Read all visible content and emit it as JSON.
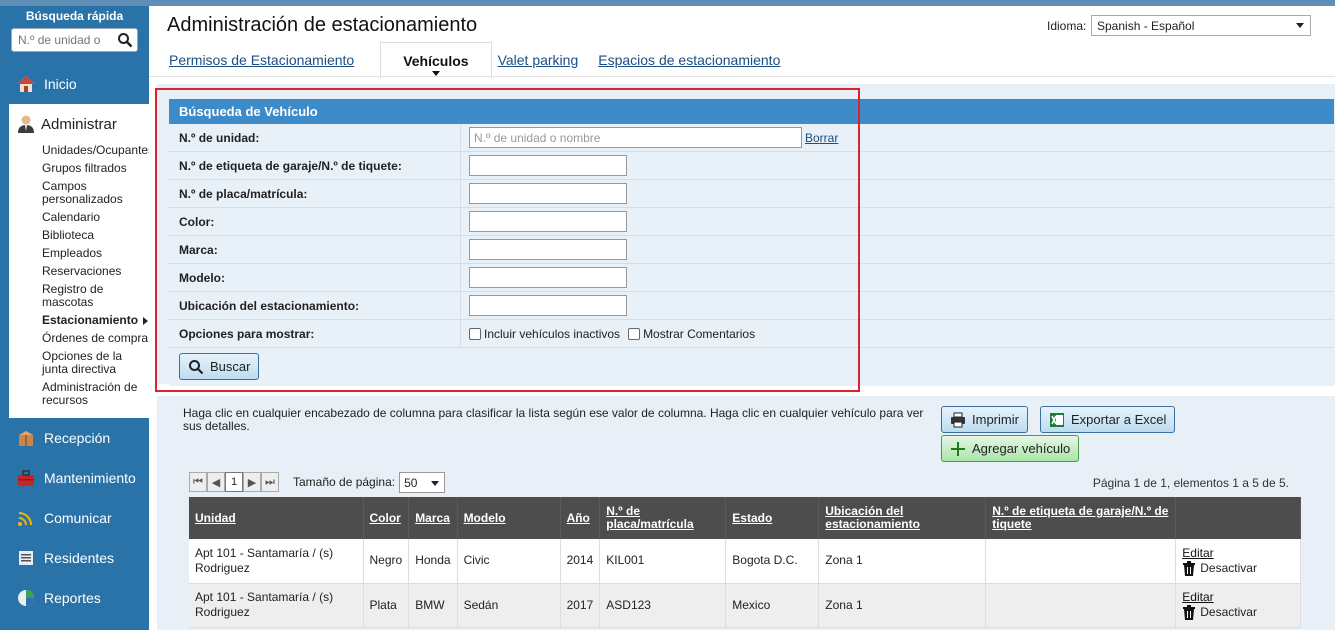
{
  "sidebar": {
    "quick_search_title": "Búsqueda rápida",
    "quick_search_placeholder": "N.º de unidad o",
    "nav": {
      "inicio": "Inicio",
      "administrar": "Administrar",
      "recepcion": "Recepción",
      "mantenimiento": "Mantenimiento",
      "comunicar": "Comunicar",
      "residentes": "Residentes",
      "reportes": "Reportes"
    },
    "admin_items": [
      "Unidades/Ocupantes",
      "Grupos filtrados",
      "Campos personalizados",
      "Calendario",
      "Biblioteca",
      "Empleados",
      "Reservaciones",
      "Registro de mascotas",
      "Estacionamiento",
      "Órdenes de compra",
      "Opciones de la junta directiva",
      "Administración de recursos"
    ]
  },
  "header": {
    "title": "Administración de estacionamiento",
    "language_label": "Idioma:",
    "language_value": "Spanish - Español"
  },
  "tabs": [
    "Permisos de Estacionamiento",
    "Vehículos",
    "Valet parking",
    "Espacios de estacionamiento"
  ],
  "search": {
    "title": "Búsqueda de Vehículo",
    "unit_label": "N.º de unidad:",
    "unit_placeholder": "N.º de unidad o nombre",
    "clear_label": "Borrar",
    "tag_label": "N.º de etiqueta de garaje/N.º de tiquete:",
    "plate_label": "N.º de placa/matrícula:",
    "color_label": "Color:",
    "brand_label": "Marca:",
    "model_label": "Modelo:",
    "location_label": "Ubicación del estacionamiento:",
    "options_label": "Opciones para mostrar:",
    "opt_inactive": "Incluir vehículos inactivos",
    "opt_comments": "Mostrar Comentarios",
    "search_button": "Buscar"
  },
  "list": {
    "hint": "Haga clic en cualquier encabezado de columna para clasificar la lista según ese valor de columna. Haga clic en cualquier vehículo para ver sus detalles.",
    "print_button": "Imprimir",
    "excel_button": "Exportar a Excel",
    "add_button": "Agregar vehículo",
    "page_size_label": "Tamaño de página:",
    "page_size_value": "50",
    "current_page": "1",
    "page_info": "Página 1 de 1, elementos 1 a 5 de 5.",
    "columns": [
      "Unidad",
      "Color",
      "Marca",
      "Modelo",
      "Año",
      "N.º de placa/matrícula",
      "Estado",
      "Ubicación del estacionamiento",
      "N.º de etiqueta de garaje/N.º de tiquete",
      ""
    ],
    "edit_label": "Editar",
    "deactivate_label": "Desactivar",
    "rows": [
      {
        "unit": "Apt 101 - Santamaría / (s) Rodriguez",
        "color": "Negro",
        "brand": "Honda",
        "model": "Civic",
        "year": "2014",
        "plate": "KIL001",
        "state": "Bogota D.C.",
        "location": "Zona 1",
        "tag": ""
      },
      {
        "unit": "Apt 101 - Santamaría / (s) Rodriguez",
        "color": "Plata",
        "brand": "BMW",
        "model": "Sedán",
        "year": "2017",
        "plate": "ASD123",
        "state": "Mexico",
        "location": "Zona 1",
        "tag": ""
      }
    ]
  }
}
